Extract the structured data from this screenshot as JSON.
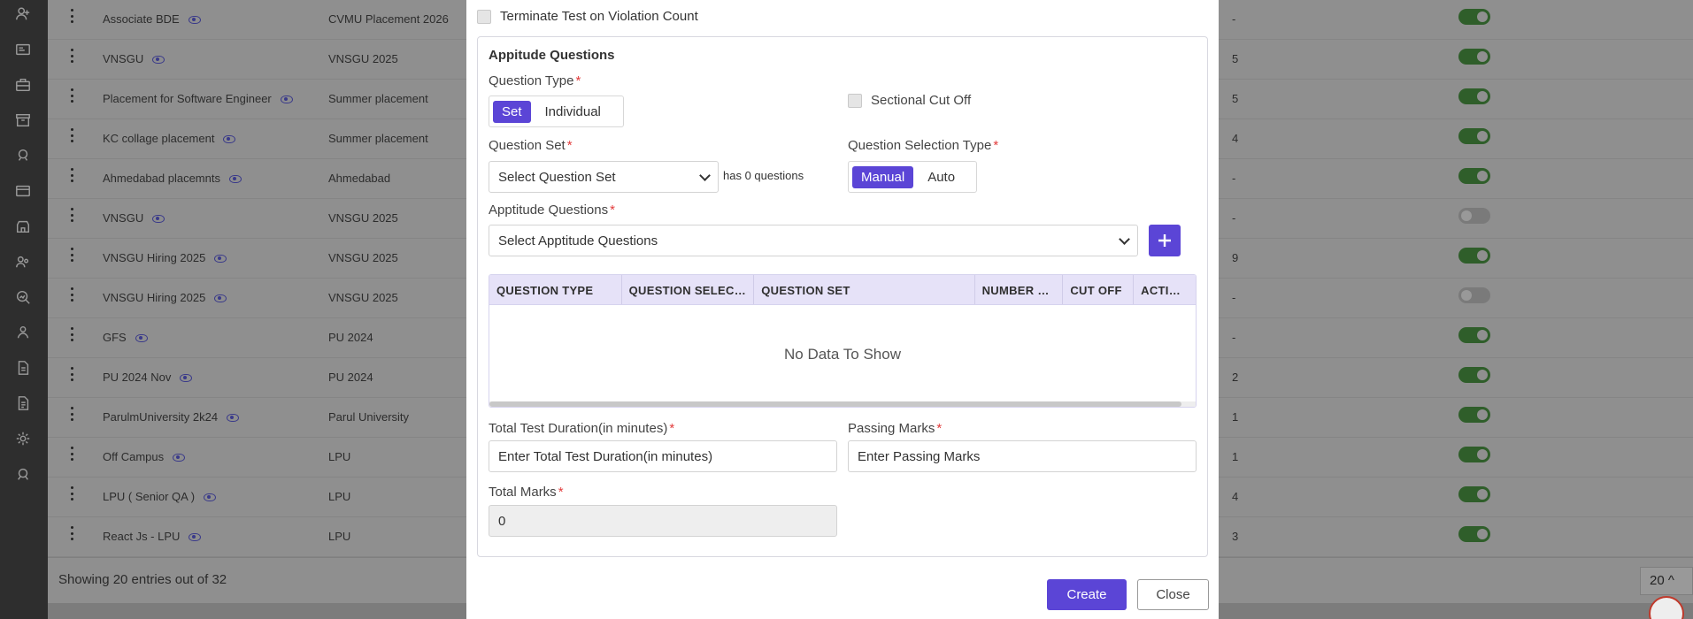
{
  "rail": {
    "icons": [
      "user-add-icon",
      "id-card-icon",
      "briefcase-icon",
      "archive-icon",
      "chat-group-icon",
      "card-icon",
      "shop-icon",
      "users-icon",
      "search-chart-icon",
      "team-icon",
      "document-icon",
      "report-icon",
      "settings-icon",
      "support-icon"
    ]
  },
  "background": {
    "rows": [
      {
        "name": "Associate BDE",
        "drive": "CVMU Placement 2026",
        "count": "-",
        "active": true
      },
      {
        "name": "VNSGU",
        "drive": "VNSGU 2025",
        "count": "5",
        "active": true
      },
      {
        "name": "Placement for Software Engineer",
        "drive": "Summer placement",
        "count": "5",
        "active": true
      },
      {
        "name": "KC collage placement",
        "drive": "Summer placement",
        "count": "4",
        "active": true
      },
      {
        "name": "Ahmedabad placemnts",
        "drive": "Ahmedabad",
        "count": "-",
        "active": true
      },
      {
        "name": "VNSGU",
        "drive": "VNSGU 2025",
        "count": "-",
        "active": false
      },
      {
        "name": "VNSGU Hiring 2025",
        "drive": "VNSGU 2025",
        "count": "9",
        "active": true
      },
      {
        "name": "VNSGU Hiring 2025",
        "drive": "VNSGU 2025",
        "count": "-",
        "active": false
      },
      {
        "name": "GFS",
        "drive": "PU 2024",
        "count": "-",
        "active": true
      },
      {
        "name": "PU 2024 Nov",
        "drive": "PU 2024",
        "count": "2",
        "active": true
      },
      {
        "name": "ParulmUniversity 2k24",
        "drive": "Parul University",
        "count": "1",
        "active": true
      },
      {
        "name": "Off Campus",
        "drive": "LPU",
        "count": "1",
        "active": true
      },
      {
        "name": "LPU ( Senior QA )",
        "drive": "LPU",
        "count": "4",
        "active": true
      },
      {
        "name": "React Js - LPU",
        "drive": "LPU",
        "count": "3",
        "active": true
      }
    ],
    "showing": "Showing 20 entries out of 32",
    "page_size": "20"
  },
  "modal": {
    "terminate_label": "Terminate Test on Violation Count",
    "section_title": "Appitude Questions",
    "question_type_label": "Question Type",
    "question_type_options": [
      "Set",
      "Individual"
    ],
    "sectional_cutoff_label": "Sectional Cut Off",
    "question_set_label": "Question Set",
    "question_set_value": "Select Question Set",
    "question_set_hint": "has 0 questions",
    "selection_type_label": "Question Selection Type",
    "selection_type_options": [
      "Manual",
      "Auto"
    ],
    "aptitude_label": "Apptitude Questions",
    "aptitude_value": "Select Apptitude Questions",
    "table": {
      "headers": [
        "QUESTION TYPE",
        "QUESTION SELECTION TYPE",
        "QUESTION SET",
        "NUMBER OF QUESTIONS",
        "CUT OFF",
        "ACTIONS"
      ],
      "empty": "No Data To Show"
    },
    "duration_label": "Total Test Duration(in minutes)",
    "duration_placeholder": "Enter Total Test Duration(in minutes)",
    "passing_label": "Passing Marks",
    "passing_placeholder": "Enter Passing Marks",
    "total_marks_label": "Total Marks",
    "total_marks_value": "0",
    "create_label": "Create",
    "close_label": "Close"
  }
}
